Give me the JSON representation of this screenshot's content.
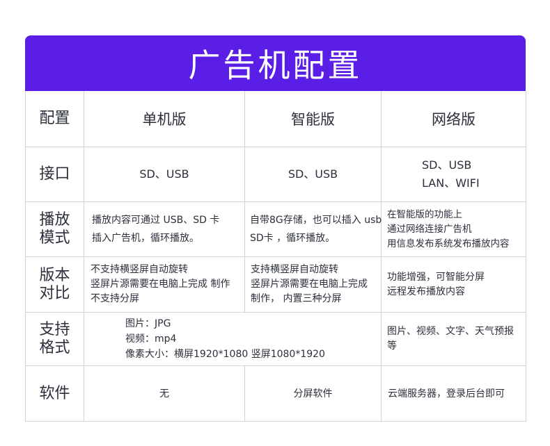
{
  "title": "广告机配置",
  "header": {
    "config": "配置",
    "col1": "单机版",
    "col2": "智能版",
    "col3": "网络版"
  },
  "rows": {
    "interface": {
      "label": "接口",
      "col1": "SD、USB",
      "col2": "SD、USB",
      "col3": [
        "SD、USB",
        "LAN、WIFI"
      ]
    },
    "playback": {
      "label": [
        "播放",
        "模式"
      ],
      "col1": [
        "播放内容可通过 USB、SD 卡",
        "插入广告机，循环播放。"
      ],
      "col2": [
        "自带8G存储，也可以插入 usb",
        "SD卡 ，循环播放。"
      ],
      "col3": [
        "在智能版的功能上",
        "通过网络连接广告机",
        "用信息发布系统发布播放内容"
      ]
    },
    "compare": {
      "label": [
        "版本",
        "对比"
      ],
      "col1": [
        "不支持横竖屏自动旋转",
        "竖屏片源需要在电脑上完成 制作",
        "不支持分屏"
      ],
      "col2": [
        "支持横竖屏自动旋转",
        "竖屏片源需要在电脑上完成",
        "制作， 内置三种分屏"
      ],
      "col3": [
        "功能增强，可智能分屏",
        "远程发布播放内容"
      ]
    },
    "format": {
      "label": [
        "支持",
        "格式"
      ],
      "col12": [
        "图片：JPG",
        "视频：mp4",
        "像素大小：横屏1920*1080  竖屏1080*1920"
      ],
      "col3": "图片、视频、文字、天气预报等"
    },
    "software": {
      "label": "软件",
      "col1": "无",
      "col2": "分屏软件",
      "col3": "云端服务器，登录后台即可"
    }
  }
}
